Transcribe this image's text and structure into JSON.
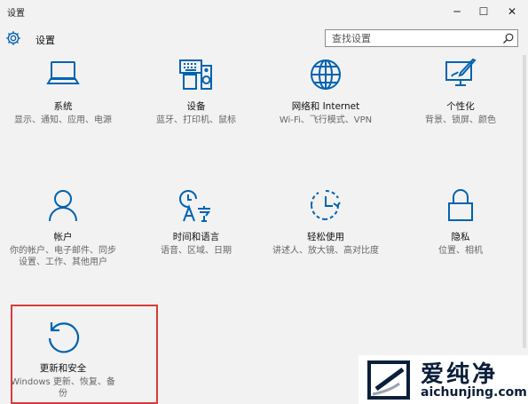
{
  "window": {
    "title": "设置",
    "minimize": "─",
    "maximize": "☐",
    "close": "✕"
  },
  "header": {
    "app_name": "设置",
    "search_placeholder": "查找设置"
  },
  "tiles": [
    {
      "id": "system",
      "title": "系统",
      "desc": "显示、通知、应用、电源",
      "icon": "laptop-icon"
    },
    {
      "id": "devices",
      "title": "设备",
      "desc": "蓝牙、打印机、鼠标",
      "icon": "keyboard-speaker-icon"
    },
    {
      "id": "network",
      "title": "网络和 Internet",
      "desc": "Wi-Fi、飞行模式、VPN",
      "icon": "globe-icon"
    },
    {
      "id": "personalization",
      "title": "个性化",
      "desc": "背景、锁屏、颜色",
      "icon": "paint-monitor-icon"
    },
    {
      "id": "accounts",
      "title": "帐户",
      "desc": "你的帐户、电子邮件、同步设置、工作、其他用户",
      "icon": "person-icon"
    },
    {
      "id": "time-language",
      "title": "时间和语言",
      "desc": "语音、区域、日期",
      "icon": "time-language-icon"
    },
    {
      "id": "ease-of-access",
      "title": "轻松使用",
      "desc": "讲述人、放大镜、高对比度",
      "icon": "clock-dashed-icon"
    },
    {
      "id": "privacy",
      "title": "隐私",
      "desc": "位置、相机",
      "icon": "lock-icon"
    },
    {
      "id": "update-security",
      "title": "更新和安全",
      "desc": "Windows 更新、恢复、备份",
      "icon": "refresh-icon"
    }
  ],
  "watermark": {
    "brand": "爱纯净",
    "url": "aichunjing.com"
  },
  "colors": {
    "accent": "#0063b1",
    "background": "#f2f2f2",
    "highlight": "#d93b3b"
  }
}
